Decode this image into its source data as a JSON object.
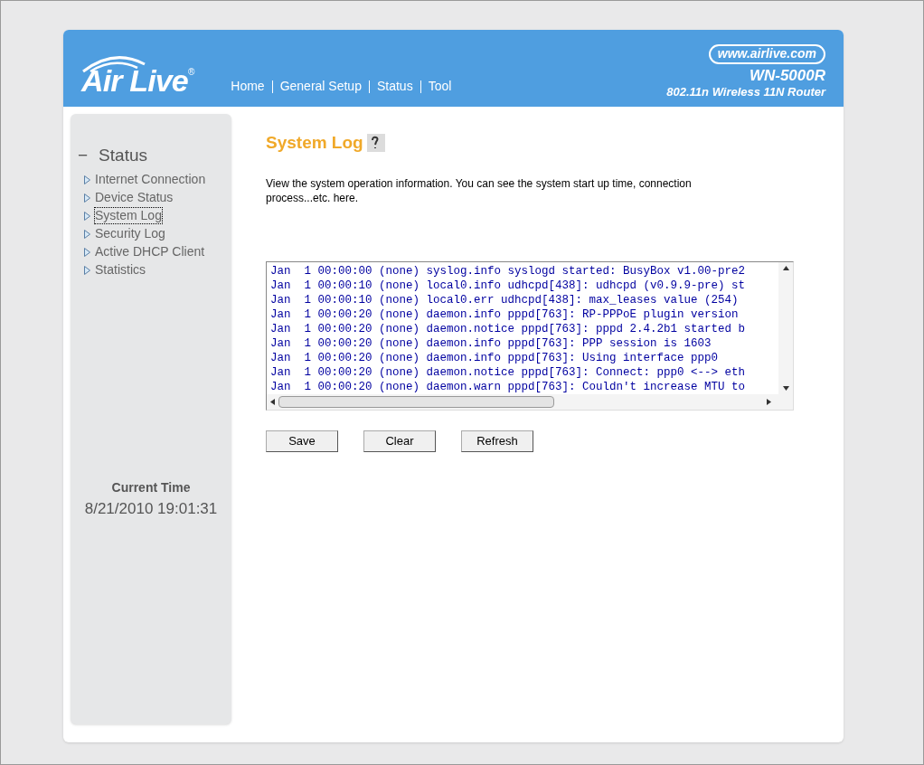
{
  "header": {
    "logo": "Air Live",
    "logo_mark": "®",
    "nav": [
      "Home",
      "General Setup",
      "Status",
      "Tool"
    ],
    "url": "www.airlive.com",
    "model": "WN-5000R",
    "subtitle": "802.11n Wireless 11N Router"
  },
  "sidebar": {
    "section": {
      "toggle": "−",
      "title": "Status",
      "expanded": true
    },
    "items": [
      {
        "label": "Internet Connection",
        "selected": false
      },
      {
        "label": "Device Status",
        "selected": false
      },
      {
        "label": "System Log",
        "selected": true
      },
      {
        "label": "Security Log",
        "selected": false
      },
      {
        "label": "Active DHCP Client",
        "selected": false
      },
      {
        "label": "Statistics",
        "selected": false
      }
    ],
    "time_label": "Current Time",
    "time_value": "8/21/2010 19:01:31"
  },
  "content": {
    "title": "System Log",
    "description": "View the system operation information. You can see the system start up time, connection process...etc. here.",
    "log_lines": [
      "Jan  1 00:00:00 (none) syslog.info syslogd started: BusyBox v1.00-pre2",
      "Jan  1 00:00:10 (none) local0.info udhcpd[438]: udhcpd (v0.9.9-pre) st",
      "Jan  1 00:00:10 (none) local0.err udhcpd[438]: max_leases value (254)",
      "Jan  1 00:00:20 (none) daemon.info pppd[763]: RP-PPPoE plugin version",
      "Jan  1 00:00:20 (none) daemon.notice pppd[763]: pppd 2.4.2b1 started b",
      "Jan  1 00:00:20 (none) daemon.info pppd[763]: PPP session is 1603",
      "Jan  1 00:00:20 (none) daemon.info pppd[763]: Using interface ppp0",
      "Jan  1 00:00:20 (none) daemon.notice pppd[763]: Connect: ppp0 <--> eth",
      "Jan  1 00:00:20 (none) daemon.warn pppd[763]: Couldn't increase MTU to"
    ],
    "buttons": [
      "Save",
      "Clear",
      "Refresh"
    ]
  }
}
